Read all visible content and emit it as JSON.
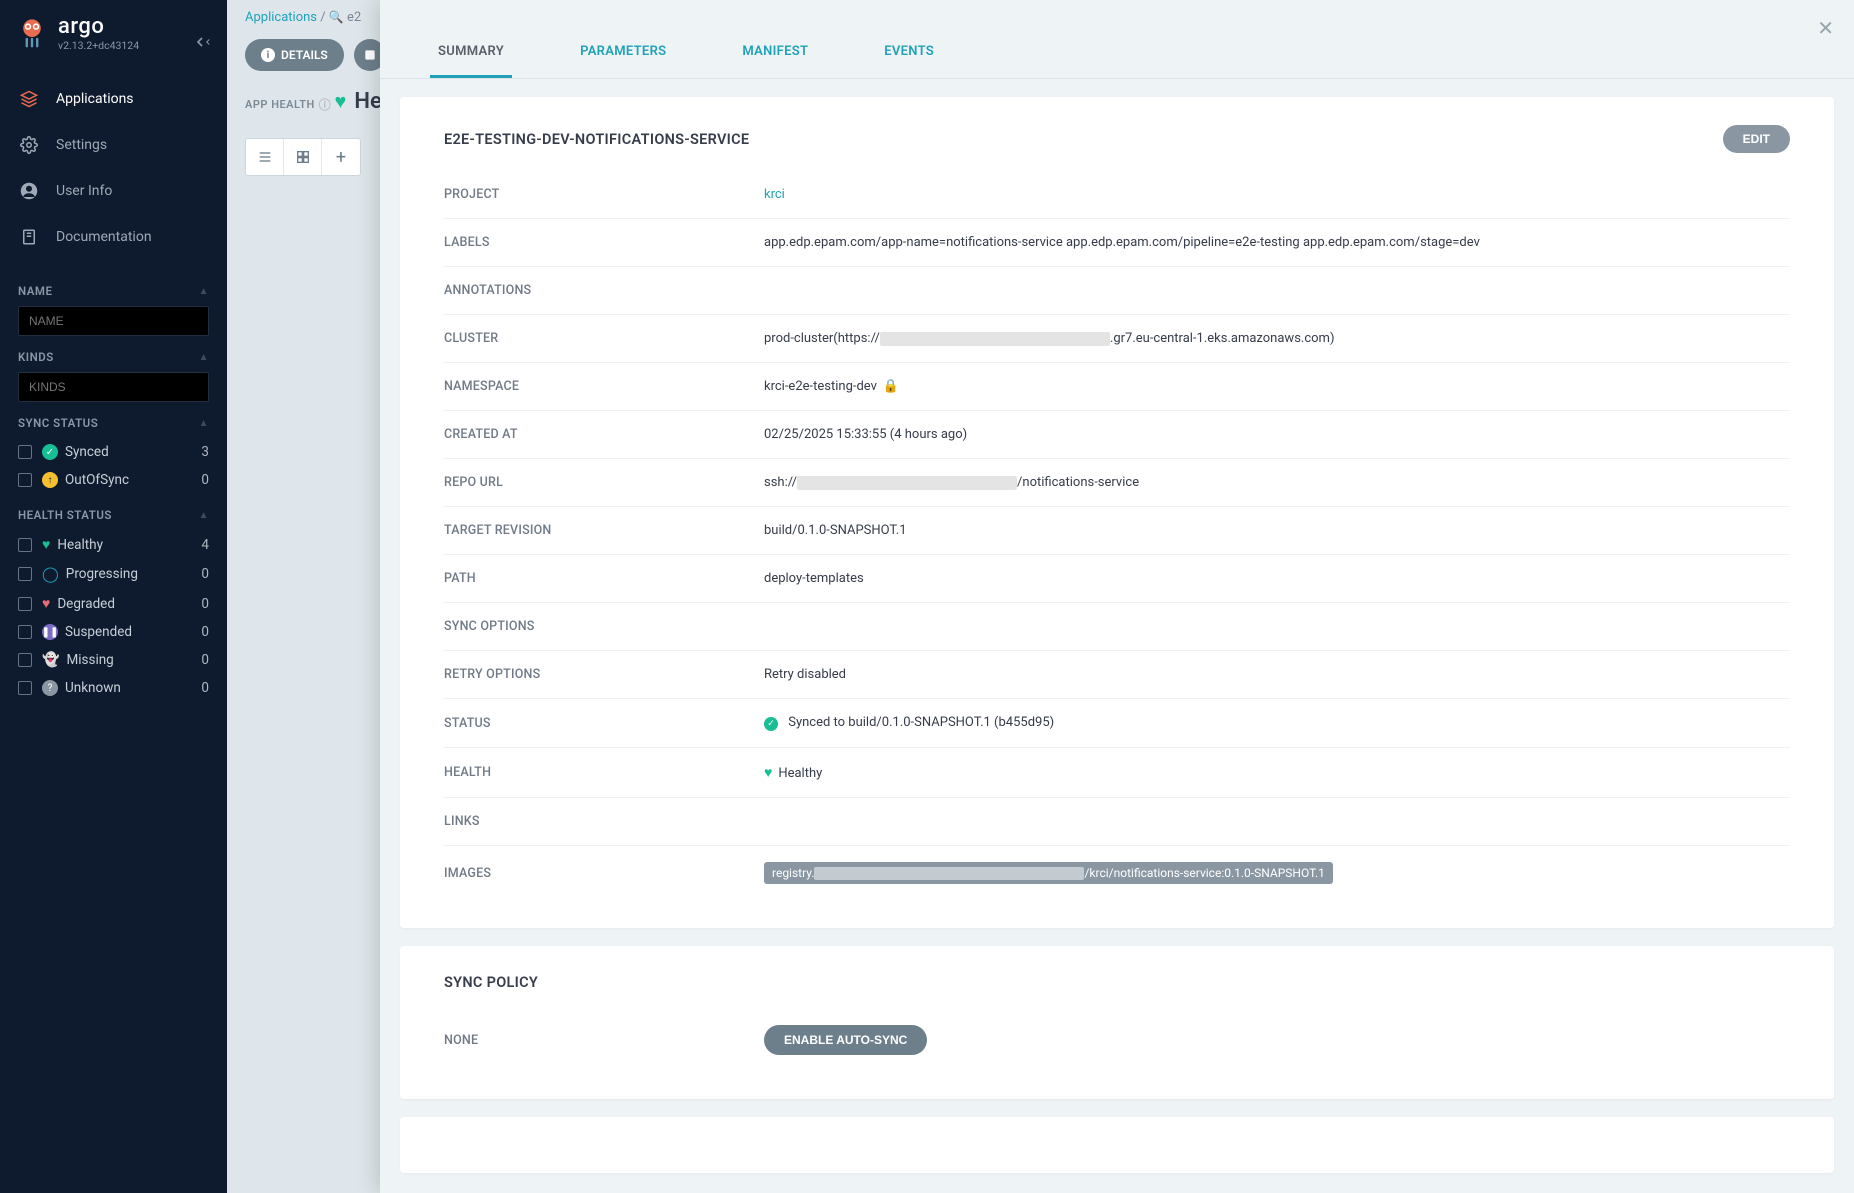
{
  "brand": {
    "name": "argo",
    "version": "v2.13.2+dc43124"
  },
  "nav": {
    "applications": "Applications",
    "settings": "Settings",
    "userinfo": "User Info",
    "documentation": "Documentation"
  },
  "filters": {
    "name": {
      "head": "NAME",
      "placeholder": "NAME"
    },
    "kinds": {
      "head": "KINDS",
      "placeholder": "KINDS"
    },
    "syncstatus": {
      "head": "SYNC STATUS",
      "items": [
        {
          "label": "Synced",
          "count": "3"
        },
        {
          "label": "OutOfSync",
          "count": "0"
        }
      ]
    },
    "healthstatus": {
      "head": "HEALTH STATUS",
      "items": [
        {
          "label": "Healthy",
          "count": "4"
        },
        {
          "label": "Progressing",
          "count": "0"
        },
        {
          "label": "Degraded",
          "count": "0"
        },
        {
          "label": "Suspended",
          "count": "0"
        },
        {
          "label": "Missing",
          "count": "0"
        },
        {
          "label": "Unknown",
          "count": "0"
        }
      ]
    }
  },
  "breadcrumb": {
    "root": "Applications",
    "search": "e2"
  },
  "buttons": {
    "details": "DETAILS"
  },
  "apphealth": {
    "label": "APP HEALTH",
    "value": "Healthy"
  },
  "panel": {
    "tabs": {
      "summary": "SUMMARY",
      "parameters": "PARAMETERS",
      "manifest": "MANIFEST",
      "events": "EVENTS"
    },
    "title": "E2E-TESTING-DEV-NOTIFICATIONS-SERVICE",
    "edit": "EDIT",
    "fields": {
      "project": {
        "label": "PROJECT",
        "value": "krci"
      },
      "labels": {
        "label": "LABELS",
        "value": "app.edp.epam.com/app-name=notifications-service app.edp.epam.com/pipeline=e2e-testing app.edp.epam.com/stage=dev"
      },
      "annotations": {
        "label": "ANNOTATIONS",
        "value": ""
      },
      "cluster": {
        "label": "CLUSTER",
        "prefix": "prod-cluster(https://",
        "suffix": ".gr7.eu-central-1.eks.amazonaws.com)"
      },
      "namespace": {
        "label": "NAMESPACE",
        "value": "krci-e2e-testing-dev"
      },
      "createdat": {
        "label": "CREATED AT",
        "value": "02/25/2025 15:33:55  (4 hours ago)"
      },
      "repourl": {
        "label": "REPO URL",
        "prefix": "ssh://",
        "suffix": "/notifications-service"
      },
      "targetrev": {
        "label": "TARGET REVISION",
        "value": "build/0.1.0-SNAPSHOT.1"
      },
      "path": {
        "label": "PATH",
        "value": "deploy-templates"
      },
      "syncoptions": {
        "label": "SYNC OPTIONS",
        "value": ""
      },
      "retry": {
        "label": "RETRY OPTIONS",
        "value": "Retry disabled"
      },
      "status": {
        "label": "STATUS",
        "value": "Synced to build/0.1.0-SNAPSHOT.1 (b455d95)"
      },
      "health": {
        "label": "HEALTH",
        "value": "Healthy"
      },
      "links": {
        "label": "LINKS",
        "value": ""
      },
      "images": {
        "label": "IMAGES",
        "prefix": "registry.",
        "suffix": "/krci/notifications-service:0.1.0-SNAPSHOT.1"
      }
    },
    "syncpolicy": {
      "title": "SYNC POLICY",
      "none_label": "NONE",
      "enable_btn": "ENABLE AUTO-SYNC"
    }
  }
}
